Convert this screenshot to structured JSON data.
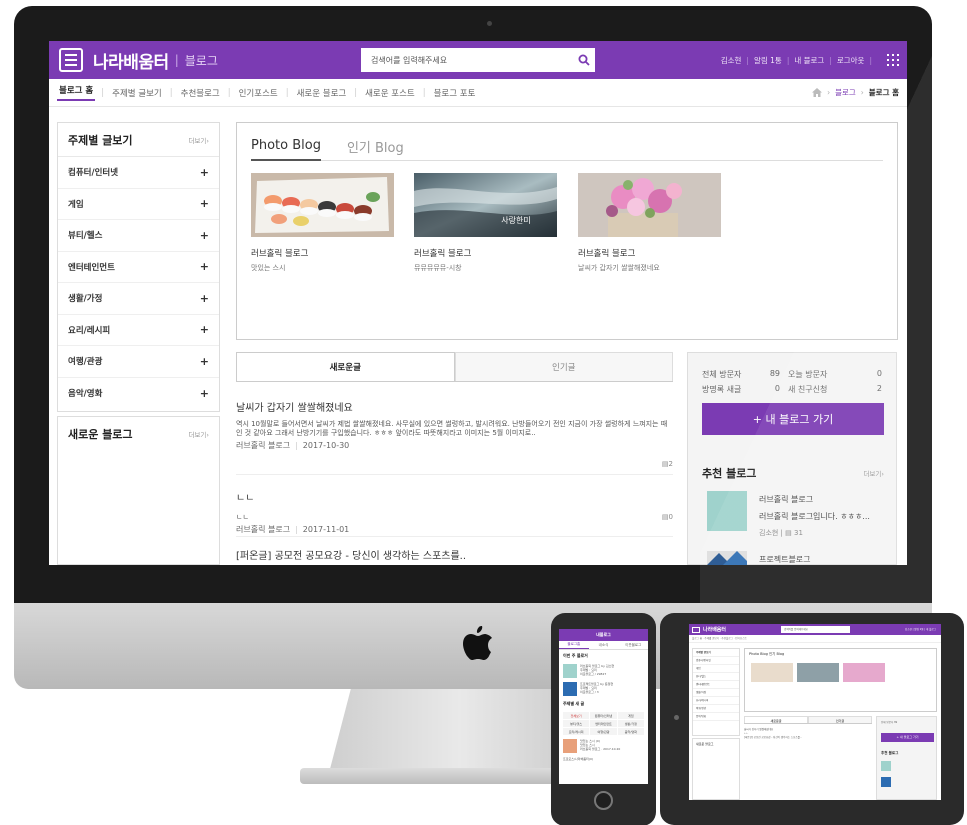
{
  "desktop": {
    "logo": "나라배움터",
    "logo_sub": "블로그",
    "search_placeholder": "검색어를 입력해주세요",
    "top_links": [
      "김소현",
      "알림 1통",
      "내 블로그",
      "로그아웃"
    ],
    "nav": [
      "블로그 홈",
      "주제별 글보기",
      "추천블로그",
      "인기포스트",
      "새로운 블로그",
      "새로운 포스트",
      "블로그 포토"
    ],
    "breadcrumb": [
      "블로그",
      "블로그 홈"
    ],
    "sidebar": {
      "title": "주제별 글보기",
      "more": "더보기›",
      "categories": [
        "컴퓨터/인터넷",
        "게임",
        "뷰티/헬스",
        "엔터테인먼트",
        "생활/가정",
        "요리/레시피",
        "여행/관광",
        "음악/영화"
      ]
    },
    "sidebar2": {
      "title": "새로운 블로그",
      "more": "더보기›"
    },
    "photo_tabs": [
      "Photo Blog",
      "인기 Blog"
    ],
    "photos": [
      {
        "blog": "러브홀릭 블로그",
        "caption": "맛있는 스시"
      },
      {
        "blog": "러브홀릭 블로그",
        "caption": "뮤뮤뮤뮤뮤-시창"
      },
      {
        "blog": "러브홀릭 블로그",
        "caption": "날씨가 갑자기 쌀쌀해졌네요"
      }
    ],
    "photo_overlay_text": "사랑한미",
    "list_tabs": [
      "새로운글",
      "인기글"
    ],
    "posts": [
      {
        "title": "날씨가 갑자기 쌀쌀해졌네요",
        "body": "역시 10월말로 들어서면서 날씨가 제법 쌀쌀해졌네요. 사무실에 있으면 썰렁하고, 발시려워요. 난방들어오기 전인 지금이 가장 썰렁하게 느껴지는 때인 것 같아요 그래서 난방기기를 구입했습니다. ㅎㅎㅎ 앞이라도 따뜻해지라고 이미지는 5월 이미지로..",
        "author": "러브홀릭 블로그",
        "date": "2017-10-30",
        "comments": "2"
      },
      {
        "title": "ㄴㄴ",
        "body": "ㄴㄴ",
        "author": "러브홀릭 블로그",
        "date": "2017-11-01",
        "comments": "0"
      },
      {
        "title": "[퍼온글] 공모전 공모요강 - 당신이 생각하는 스포츠를..",
        "body": "",
        "author": "",
        "date": "",
        "comments": ""
      }
    ],
    "stats": {
      "total_label": "전체 방문자",
      "total": "89",
      "today_label": "오늘 방문자",
      "today": "0",
      "guest_label": "방명록 새글",
      "guest": "0",
      "friend_label": "새 친구신청",
      "friend": "2"
    },
    "go_button": "+ 내 블로그 가기",
    "recommend": {
      "title": "추천 블로그",
      "more": "더보기›",
      "items": [
        {
          "name": "러브홀릭 블로그",
          "desc": "러브홀릭 블로그입니다. ㅎㅎㅎ...",
          "owner": "김소현",
          "count": "31"
        },
        {
          "name": "프로젝트블로그"
        }
      ]
    }
  },
  "phone": {
    "header": "내블로그",
    "tabs": [
      "블로그홈",
      "내소식",
      "이웃블로그"
    ],
    "section1": "이번 주 블로거",
    "items": [
      {
        "name": "러브홀릭 블로그 by 김소현",
        "l2": "주제별 : 요리",
        "l3": "이웃블로그 / 29827"
      },
      {
        "name": "프로젝트블로그 by 윤정현",
        "l2": "주제별 : 요리",
        "l3": "이웃블로그 / 3"
      }
    ],
    "section2": "주제별 새 글",
    "grid": [
      "전체보기",
      "컴퓨터/인터넷",
      "게임",
      "뷰티/헬스",
      "엔터테인먼트",
      "생활/가정",
      "요리/레시피",
      "여행/관광",
      "음악/영화"
    ],
    "post": {
      "title": "맛있는 스시 (0)",
      "l2": "맛있는 스시",
      "l3": "러브홀릭 블로그 · 2017.10.20"
    },
    "footer": "프로모스/나라배움터(0)"
  },
  "tablet": {
    "logo": "나라배움터",
    "search": "검색어를 입력해주세요",
    "photo_tabs": "Photo Blog   인기 Blog",
    "list_tabs": [
      "새로운글",
      "인기글"
    ],
    "button": "+ 내 블로그 가기",
    "recommend": "추천 블로그"
  },
  "colors": {
    "accent": "#7b3bb3",
    "frame": "#1b1b1b",
    "thumb": "#9fd2cc"
  }
}
